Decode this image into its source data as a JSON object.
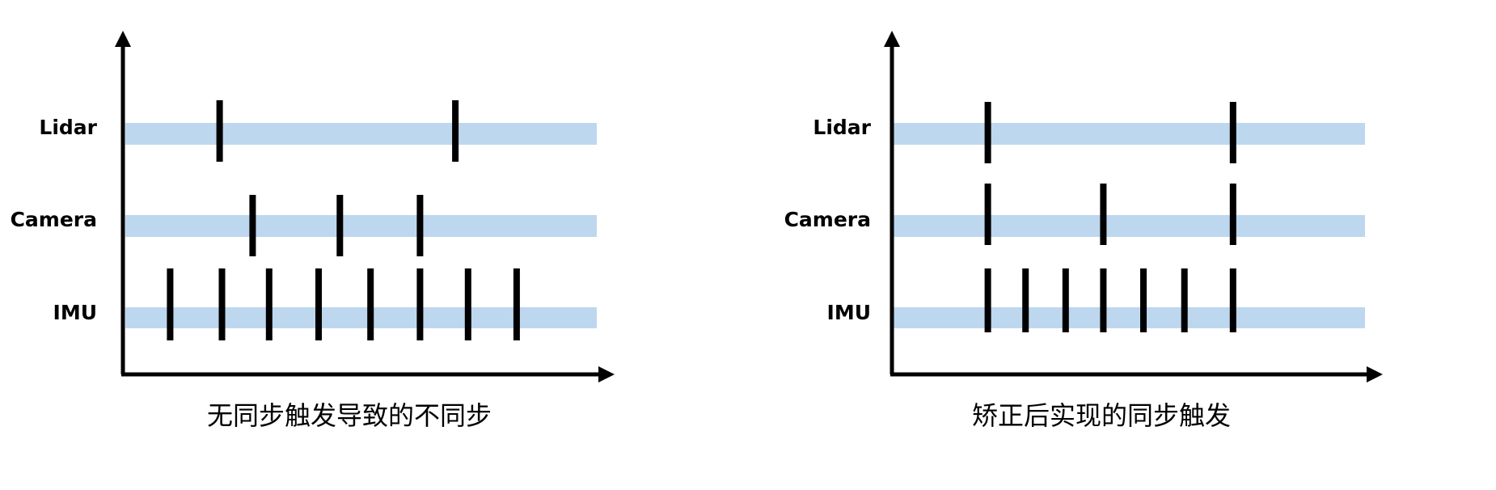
{
  "colors": {
    "band": "#bdd7ee",
    "tick": "#000000",
    "axis": "#000000"
  },
  "panels": [
    {
      "caption": "无同步触发导致的不同步",
      "rows": [
        {
          "label": "Lidar",
          "ticks": [
            0.2,
            0.7
          ]
        },
        {
          "label": "Camera",
          "ticks": [
            0.27,
            0.455,
            0.625
          ]
        },
        {
          "label": "IMU",
          "ticks": [
            0.095,
            0.205,
            0.305,
            0.41,
            0.52,
            0.625,
            0.727,
            0.83
          ]
        }
      ]
    },
    {
      "caption": "矫正后实现的同步触发",
      "rows": [
        {
          "label": "Lidar",
          "ticks": [
            0.2,
            0.72
          ]
        },
        {
          "label": "Camera",
          "ticks": [
            0.2,
            0.445,
            0.72
          ]
        },
        {
          "label": "IMU",
          "ticks": [
            0.2,
            0.28,
            0.365,
            0.445,
            0.53,
            0.617,
            0.72
          ]
        }
      ]
    }
  ]
}
